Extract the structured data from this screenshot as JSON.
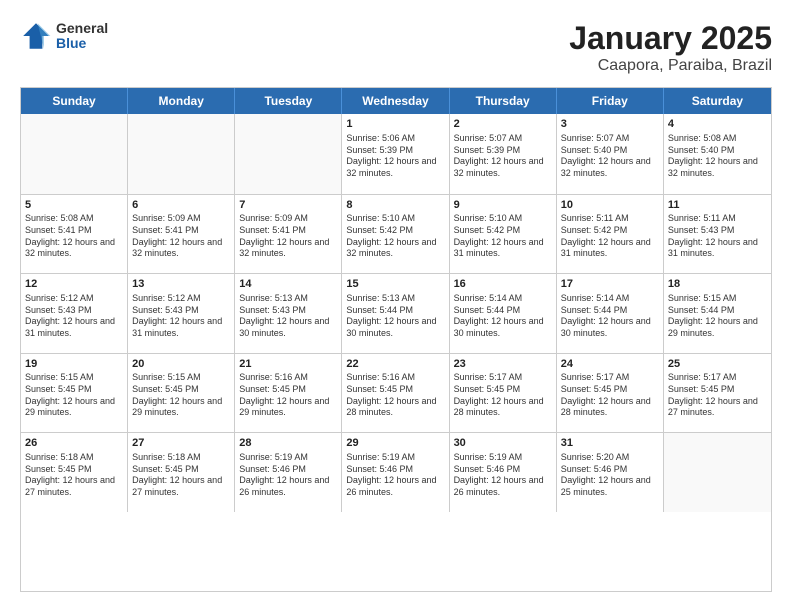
{
  "header": {
    "logo": {
      "general": "General",
      "blue": "Blue"
    },
    "title": "January 2025",
    "location": "Caapora, Paraiba, Brazil"
  },
  "dayHeaders": [
    "Sunday",
    "Monday",
    "Tuesday",
    "Wednesday",
    "Thursday",
    "Friday",
    "Saturday"
  ],
  "weeks": [
    [
      {
        "date": "",
        "sunrise": "",
        "sunset": "",
        "daylight": ""
      },
      {
        "date": "",
        "sunrise": "",
        "sunset": "",
        "daylight": ""
      },
      {
        "date": "",
        "sunrise": "",
        "sunset": "",
        "daylight": ""
      },
      {
        "date": "1",
        "sunrise": "Sunrise: 5:06 AM",
        "sunset": "Sunset: 5:39 PM",
        "daylight": "Daylight: 12 hours and 32 minutes."
      },
      {
        "date": "2",
        "sunrise": "Sunrise: 5:07 AM",
        "sunset": "Sunset: 5:39 PM",
        "daylight": "Daylight: 12 hours and 32 minutes."
      },
      {
        "date": "3",
        "sunrise": "Sunrise: 5:07 AM",
        "sunset": "Sunset: 5:40 PM",
        "daylight": "Daylight: 12 hours and 32 minutes."
      },
      {
        "date": "4",
        "sunrise": "Sunrise: 5:08 AM",
        "sunset": "Sunset: 5:40 PM",
        "daylight": "Daylight: 12 hours and 32 minutes."
      }
    ],
    [
      {
        "date": "5",
        "sunrise": "Sunrise: 5:08 AM",
        "sunset": "Sunset: 5:41 PM",
        "daylight": "Daylight: 12 hours and 32 minutes."
      },
      {
        "date": "6",
        "sunrise": "Sunrise: 5:09 AM",
        "sunset": "Sunset: 5:41 PM",
        "daylight": "Daylight: 12 hours and 32 minutes."
      },
      {
        "date": "7",
        "sunrise": "Sunrise: 5:09 AM",
        "sunset": "Sunset: 5:41 PM",
        "daylight": "Daylight: 12 hours and 32 minutes."
      },
      {
        "date": "8",
        "sunrise": "Sunrise: 5:10 AM",
        "sunset": "Sunset: 5:42 PM",
        "daylight": "Daylight: 12 hours and 32 minutes."
      },
      {
        "date": "9",
        "sunrise": "Sunrise: 5:10 AM",
        "sunset": "Sunset: 5:42 PM",
        "daylight": "Daylight: 12 hours and 31 minutes."
      },
      {
        "date": "10",
        "sunrise": "Sunrise: 5:11 AM",
        "sunset": "Sunset: 5:42 PM",
        "daylight": "Daylight: 12 hours and 31 minutes."
      },
      {
        "date": "11",
        "sunrise": "Sunrise: 5:11 AM",
        "sunset": "Sunset: 5:43 PM",
        "daylight": "Daylight: 12 hours and 31 minutes."
      }
    ],
    [
      {
        "date": "12",
        "sunrise": "Sunrise: 5:12 AM",
        "sunset": "Sunset: 5:43 PM",
        "daylight": "Daylight: 12 hours and 31 minutes."
      },
      {
        "date": "13",
        "sunrise": "Sunrise: 5:12 AM",
        "sunset": "Sunset: 5:43 PM",
        "daylight": "Daylight: 12 hours and 31 minutes."
      },
      {
        "date": "14",
        "sunrise": "Sunrise: 5:13 AM",
        "sunset": "Sunset: 5:43 PM",
        "daylight": "Daylight: 12 hours and 30 minutes."
      },
      {
        "date": "15",
        "sunrise": "Sunrise: 5:13 AM",
        "sunset": "Sunset: 5:44 PM",
        "daylight": "Daylight: 12 hours and 30 minutes."
      },
      {
        "date": "16",
        "sunrise": "Sunrise: 5:14 AM",
        "sunset": "Sunset: 5:44 PM",
        "daylight": "Daylight: 12 hours and 30 minutes."
      },
      {
        "date": "17",
        "sunrise": "Sunrise: 5:14 AM",
        "sunset": "Sunset: 5:44 PM",
        "daylight": "Daylight: 12 hours and 30 minutes."
      },
      {
        "date": "18",
        "sunrise": "Sunrise: 5:15 AM",
        "sunset": "Sunset: 5:44 PM",
        "daylight": "Daylight: 12 hours and 29 minutes."
      }
    ],
    [
      {
        "date": "19",
        "sunrise": "Sunrise: 5:15 AM",
        "sunset": "Sunset: 5:45 PM",
        "daylight": "Daylight: 12 hours and 29 minutes."
      },
      {
        "date": "20",
        "sunrise": "Sunrise: 5:15 AM",
        "sunset": "Sunset: 5:45 PM",
        "daylight": "Daylight: 12 hours and 29 minutes."
      },
      {
        "date": "21",
        "sunrise": "Sunrise: 5:16 AM",
        "sunset": "Sunset: 5:45 PM",
        "daylight": "Daylight: 12 hours and 29 minutes."
      },
      {
        "date": "22",
        "sunrise": "Sunrise: 5:16 AM",
        "sunset": "Sunset: 5:45 PM",
        "daylight": "Daylight: 12 hours and 28 minutes."
      },
      {
        "date": "23",
        "sunrise": "Sunrise: 5:17 AM",
        "sunset": "Sunset: 5:45 PM",
        "daylight": "Daylight: 12 hours and 28 minutes."
      },
      {
        "date": "24",
        "sunrise": "Sunrise: 5:17 AM",
        "sunset": "Sunset: 5:45 PM",
        "daylight": "Daylight: 12 hours and 28 minutes."
      },
      {
        "date": "25",
        "sunrise": "Sunrise: 5:17 AM",
        "sunset": "Sunset: 5:45 PM",
        "daylight": "Daylight: 12 hours and 27 minutes."
      }
    ],
    [
      {
        "date": "26",
        "sunrise": "Sunrise: 5:18 AM",
        "sunset": "Sunset: 5:45 PM",
        "daylight": "Daylight: 12 hours and 27 minutes."
      },
      {
        "date": "27",
        "sunrise": "Sunrise: 5:18 AM",
        "sunset": "Sunset: 5:45 PM",
        "daylight": "Daylight: 12 hours and 27 minutes."
      },
      {
        "date": "28",
        "sunrise": "Sunrise: 5:19 AM",
        "sunset": "Sunset: 5:46 PM",
        "daylight": "Daylight: 12 hours and 26 minutes."
      },
      {
        "date": "29",
        "sunrise": "Sunrise: 5:19 AM",
        "sunset": "Sunset: 5:46 PM",
        "daylight": "Daylight: 12 hours and 26 minutes."
      },
      {
        "date": "30",
        "sunrise": "Sunrise: 5:19 AM",
        "sunset": "Sunset: 5:46 PM",
        "daylight": "Daylight: 12 hours and 26 minutes."
      },
      {
        "date": "31",
        "sunrise": "Sunrise: 5:20 AM",
        "sunset": "Sunset: 5:46 PM",
        "daylight": "Daylight: 12 hours and 25 minutes."
      },
      {
        "date": "",
        "sunrise": "",
        "sunset": "",
        "daylight": ""
      }
    ]
  ]
}
